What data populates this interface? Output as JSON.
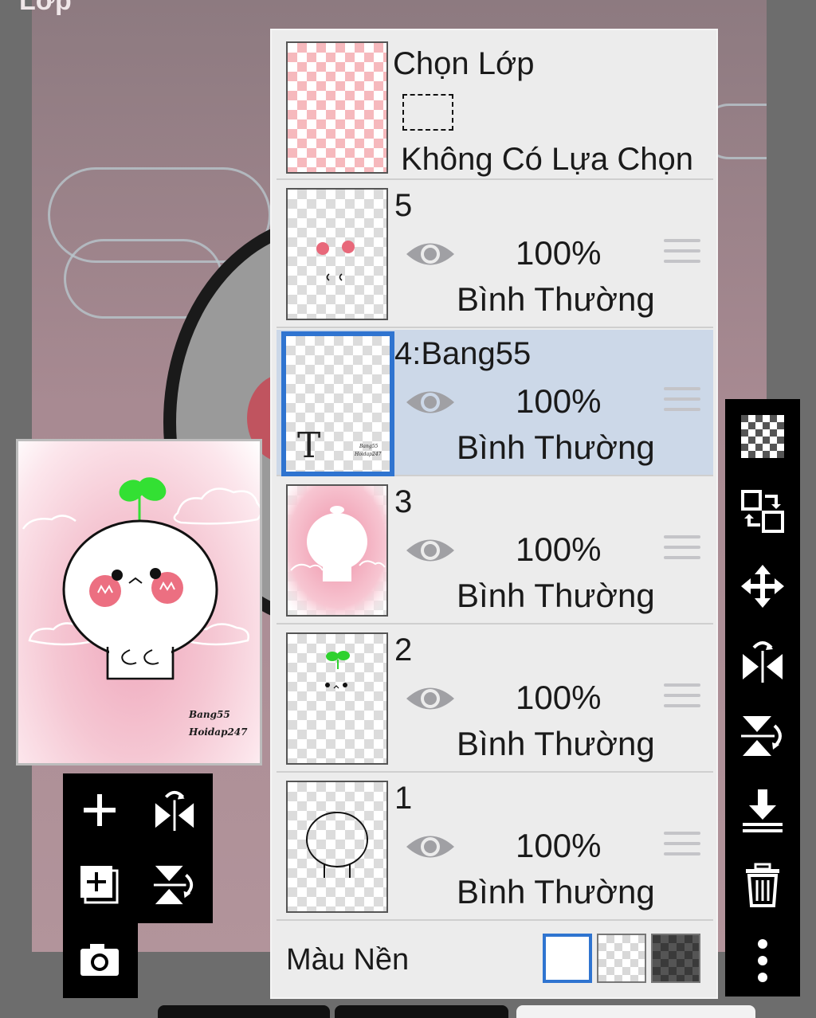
{
  "window": {
    "title": "Lớp"
  },
  "selection_layer": {
    "title": "Chọn Lớp",
    "status": "Không Có Lựa Chọn"
  },
  "layers": [
    {
      "name": "5",
      "opacity": "100%",
      "blend": "Bình Thường",
      "selected": false
    },
    {
      "name": "4:Bang55",
      "opacity": "100%",
      "blend": "Bình Thường",
      "selected": true,
      "thumb_text": "T"
    },
    {
      "name": "3",
      "opacity": "100%",
      "blend": "Bình Thường",
      "selected": false
    },
    {
      "name": "2",
      "opacity": "100%",
      "blend": "Bình Thường",
      "selected": false
    },
    {
      "name": "1",
      "opacity": "100%",
      "blend": "Bình Thường",
      "selected": false
    }
  ],
  "background": {
    "label": "Màu Nền",
    "selected": "white"
  },
  "preview": {
    "watermark_line1": "Bang55",
    "watermark_line2": "Hoidap247"
  },
  "right_toolbar": [
    "transparency-icon",
    "swap-layer-icon",
    "move-icon",
    "flip-horizontal-icon",
    "flip-vertical-icon",
    "merge-down-icon",
    "trash-icon",
    "more-icon"
  ],
  "left_toolbar": [
    "add-layer-icon",
    "flip-horizontal-icon",
    "add-copy-layer-icon",
    "flip-vertical-icon",
    "camera-icon"
  ],
  "colors": {
    "accent": "#2f74d0",
    "selected_row": "#ccd8e8",
    "panel": "#ececec"
  }
}
